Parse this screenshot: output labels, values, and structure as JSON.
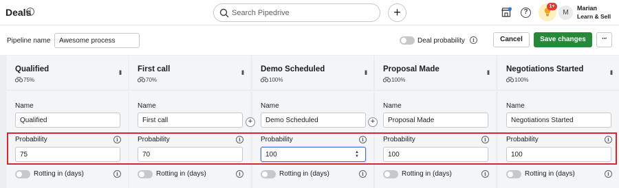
{
  "header": {
    "title": "Deals",
    "info_icon": "info-icon",
    "search_placeholder": "Search Pipedrive",
    "add_label": "+",
    "tips_badge": "1+",
    "user_initial": "M",
    "user_name": "Marian",
    "user_company": "Learn & Sell"
  },
  "settings": {
    "pipeline_label": "Pipeline name",
    "pipeline_value": "Awesome process",
    "deal_probability_label": "Deal probability",
    "cancel_label": "Cancel",
    "save_label": "Save changes",
    "more_label": "···"
  },
  "stage_labels": {
    "name": "Name",
    "probability": "Probability",
    "rotting": "Rotting in (days)"
  },
  "stages": [
    {
      "name": "Qualified",
      "percent": "75%",
      "name_value": "Qualified",
      "probability_value": "75"
    },
    {
      "name": "First call",
      "percent": "70%",
      "name_value": "First call",
      "probability_value": "70"
    },
    {
      "name": "Demo Scheduled",
      "percent": "100%",
      "name_value": "Demo Scheduled",
      "probability_value": "100"
    },
    {
      "name": "Proposal Made",
      "percent": "100%",
      "name_value": "Proposal Made",
      "probability_value": "100"
    },
    {
      "name": "Negotiations Started",
      "percent": "100%",
      "name_value": "Negotiations Started",
      "probability_value": "100"
    }
  ],
  "colors": {
    "accent_green": "#26893a",
    "highlight_red": "#d8262c",
    "focus_blue": "#3a6fd8"
  }
}
